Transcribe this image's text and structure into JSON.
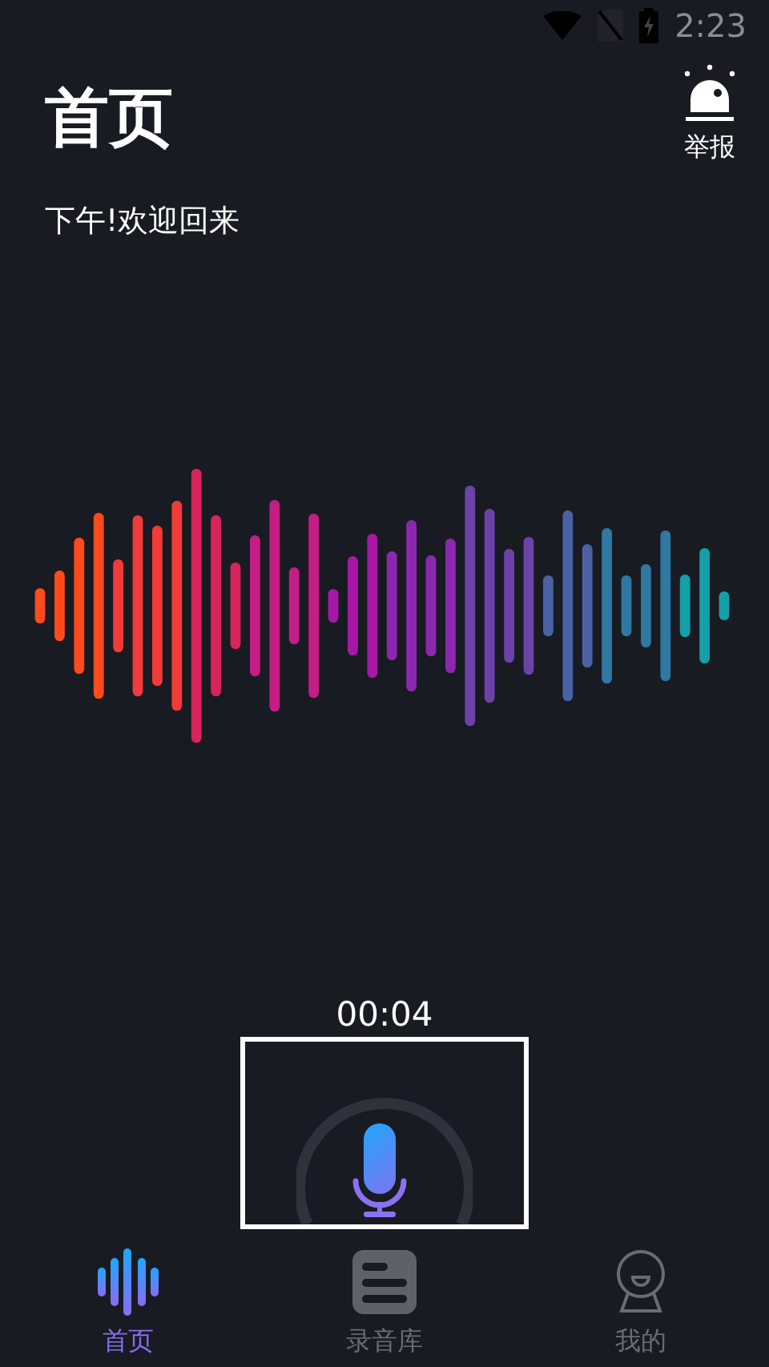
{
  "status_bar": {
    "time": "2:23"
  },
  "header": {
    "title": "首页",
    "greeting": "下午!欢迎回来",
    "report_button": {
      "label": "举报"
    }
  },
  "recorder": {
    "elapsed": "00:04"
  },
  "tabs": [
    {
      "label": "首页",
      "selected": true,
      "kind": "wave"
    },
    {
      "label": "录音库",
      "selected": false,
      "kind": "list"
    },
    {
      "label": "我的",
      "selected": false,
      "kind": "person"
    }
  ]
}
